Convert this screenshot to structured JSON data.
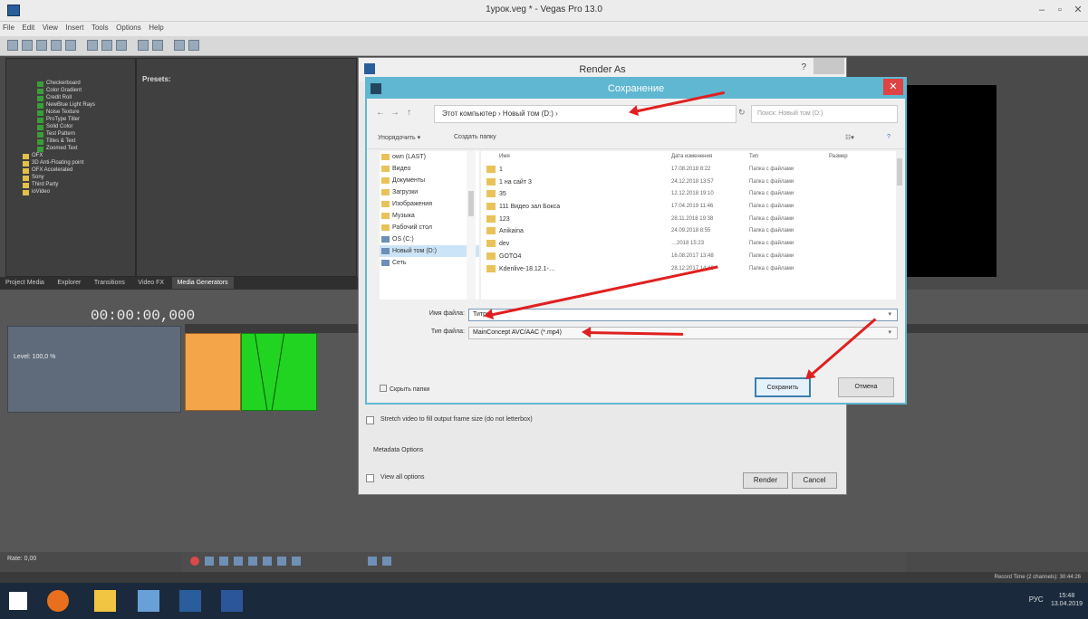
{
  "window": {
    "title": "1урок.veg * - Vegas Pro 13.0"
  },
  "menu": [
    "File",
    "Edit",
    "View",
    "Insert",
    "Tools",
    "Options",
    "Help"
  ],
  "explorer": {
    "tree": [
      "Checkerboard",
      "Color Gradient",
      "Credit Roll",
      "NewBlue Light Rays",
      "Noise Texture",
      "ProType Titler",
      "Solid Color",
      "Test Pattern",
      "Titles & Text",
      "Zoomed Text"
    ],
    "folders": [
      "OFX",
      "3D Anti-Floating point",
      "OFX Accelerated",
      "Sony",
      "Third Party",
      "ioVideo"
    ]
  },
  "presets_label": "Presets:",
  "tabs": [
    "Project Media",
    "Explorer",
    "Transitions",
    "Video FX",
    "Media Generators"
  ],
  "timecode": "00:00:00,000",
  "track": {
    "level": "Level: 100,0 %"
  },
  "rate_label": "Rate: 0,00",
  "status_right": "Record Time (2 channels): 30:44:26",
  "render_as": {
    "title": "Render As",
    "help": "?",
    "stretch_label": "Stretch video to fill output frame size (do not letterbox)",
    "metadata_label": "Metadata Options",
    "view_all_label": "View all options",
    "render_btn": "Render",
    "cancel_btn": "Cancel"
  },
  "save_dialog": {
    "title": "Сохранение",
    "address": "Этот компьютер › Новый том (D:) ›",
    "search_placeholder": "Поиск: Новый том (D:)",
    "organize": "Упорядочить ▾",
    "new_folder": "Создать папку",
    "columns": {
      "name": "Имя",
      "date": "Дата изменения",
      "type": "Тип",
      "size": "Размер"
    },
    "nav_items": [
      "own (LAST)",
      "Видео",
      "Документы",
      "Загрузки",
      "Изображения",
      "Музыка",
      "Рабочий стол",
      "OS (C:)",
      "Новый том (D:)",
      "Сеть"
    ],
    "files": [
      {
        "name": "1",
        "date": "17.08.2018 8:22",
        "type": "Папка с файлами"
      },
      {
        "name": "1 на сайт 3",
        "date": "24.12.2018 13:57",
        "type": "Папка с файлами"
      },
      {
        "name": "35",
        "date": "12.12.2018 19:10",
        "type": "Папка с файлами"
      },
      {
        "name": "111 Видео зал Бокса",
        "date": "17.04.2019 11:46",
        "type": "Папка с файлами"
      },
      {
        "name": "123",
        "date": "28.11.2018 19:38",
        "type": "Папка с файлами"
      },
      {
        "name": "Anikaina",
        "date": "24.09.2018 8:55",
        "type": "Папка с файлами"
      },
      {
        "name": "dev",
        "date": "…2018 15:23",
        "type": "Папка с файлами"
      },
      {
        "name": "GOTO4",
        "date": "16.08.2017 13:48",
        "type": "Папка с файлами"
      },
      {
        "name": "Kdenlive-18.12.1-…",
        "date": "28.12.2017 14:46",
        "type": "Папка с файлами"
      }
    ],
    "filename_label": "Имя файла:",
    "filename_value": "Титры",
    "filetype_label": "Тип файла:",
    "filetype_value": "MainConcept AVC/AAC (*.mp4)",
    "hide_folders": "Скрыть папки",
    "save_btn": "Сохранить",
    "cancel_btn": "Отмена"
  },
  "taskbar": {
    "lang": "РУС",
    "time": "15:48",
    "date": "13.04.2019"
  },
  "colors": {
    "annotation_arrow": "#e02020",
    "dialog_accent": "#5fb7d1",
    "clip_orange": "#f4a54a",
    "clip_green": "#21d421"
  }
}
